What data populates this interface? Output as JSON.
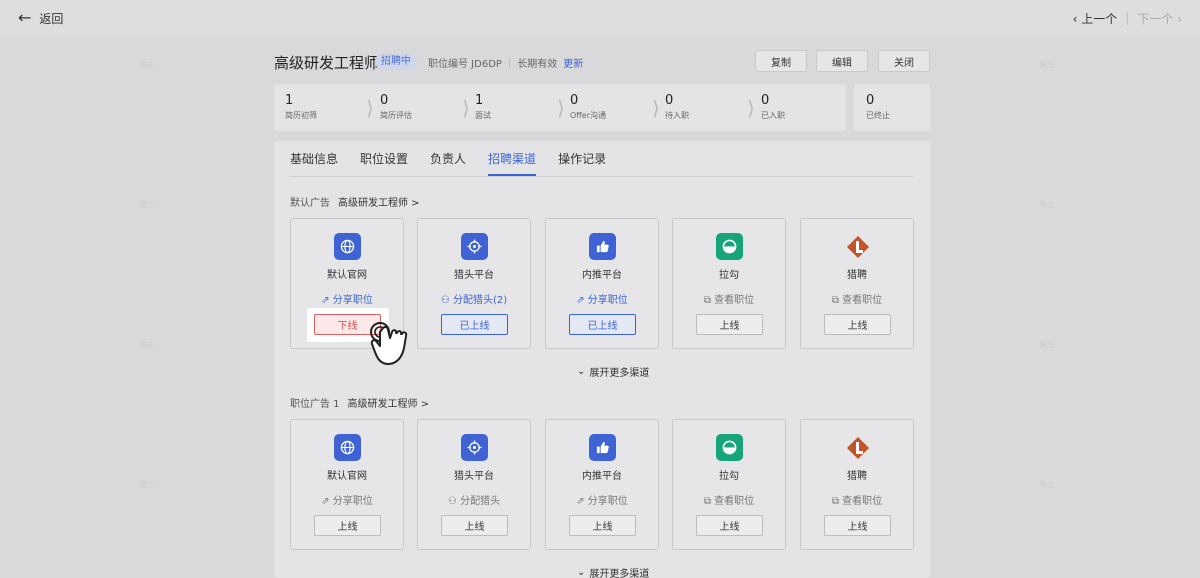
{
  "topbar": {
    "back_label": "返回",
    "prev_label": "上一个",
    "separator": "|",
    "next_label": "下一个"
  },
  "header": {
    "title": "高级研发工程师",
    "status": "招聘中",
    "job_code": "职位编号 JD6DP",
    "validity": "长期有效",
    "update_link": "更新",
    "buttons": {
      "copy": "复制",
      "edit": "编辑",
      "close": "关闭"
    }
  },
  "stats": [
    {
      "value": "1",
      "label": "简历初筛"
    },
    {
      "value": "0",
      "label": "简历评估"
    },
    {
      "value": "1",
      "label": "面试"
    },
    {
      "value": "0",
      "label": "Offer沟通"
    },
    {
      "value": "0",
      "label": "待入职"
    },
    {
      "value": "0",
      "label": "已入职"
    },
    {
      "value": "0",
      "label": "已终止"
    }
  ],
  "tabs": [
    {
      "label": "基础信息"
    },
    {
      "label": "职位设置"
    },
    {
      "label": "负责人"
    },
    {
      "label": "招聘渠道",
      "active": true
    },
    {
      "label": "操作记录"
    }
  ],
  "sections": [
    {
      "label": "默认广告",
      "job_link": "高级研发工程师 >",
      "channels": [
        {
          "name": "默认官网",
          "action": "分享职位",
          "button": "下线",
          "icon": "globe-icon",
          "color": "#3f63d4"
        },
        {
          "name": "猎头平台",
          "action": "分配猎头(2)",
          "button": "已上线",
          "icon": "crosshair-icon",
          "color": "#3f63d4"
        },
        {
          "name": "内推平台",
          "action": "分享职位",
          "button": "已上线",
          "icon": "thumbs-up-icon",
          "color": "#3f63d4"
        },
        {
          "name": "拉勾",
          "action": "查看职位",
          "button": "上线",
          "icon": "lagou-logo-icon",
          "color": "#16a47a"
        },
        {
          "name": "猎聘",
          "action": "查看职位",
          "button": "上线",
          "icon": "liepin-logo-icon",
          "color": "#c2542a"
        }
      ],
      "expand": "展开更多渠道"
    },
    {
      "label": "职位广告 1",
      "job_link": "高级研发工程师 >",
      "channels": [
        {
          "name": "默认官网",
          "action": "分享职位",
          "button": "上线",
          "icon": "globe-icon",
          "color": "#3f63d4"
        },
        {
          "name": "猎头平台",
          "action": "分配猎头",
          "button": "上线",
          "icon": "crosshair-icon",
          "color": "#3f63d4"
        },
        {
          "name": "内推平台",
          "action": "分享职位",
          "button": "上线",
          "icon": "thumbs-up-icon",
          "color": "#3f63d4"
        },
        {
          "name": "拉勾",
          "action": "查看职位",
          "button": "上线",
          "icon": "lagou-logo-icon",
          "color": "#16a47a"
        },
        {
          "name": "猎聘",
          "action": "查看职位",
          "button": "上线",
          "icon": "liepin-logo-icon",
          "color": "#c2542a"
        }
      ],
      "expand": "展开更多渠道"
    }
  ],
  "watermark": "陈三"
}
